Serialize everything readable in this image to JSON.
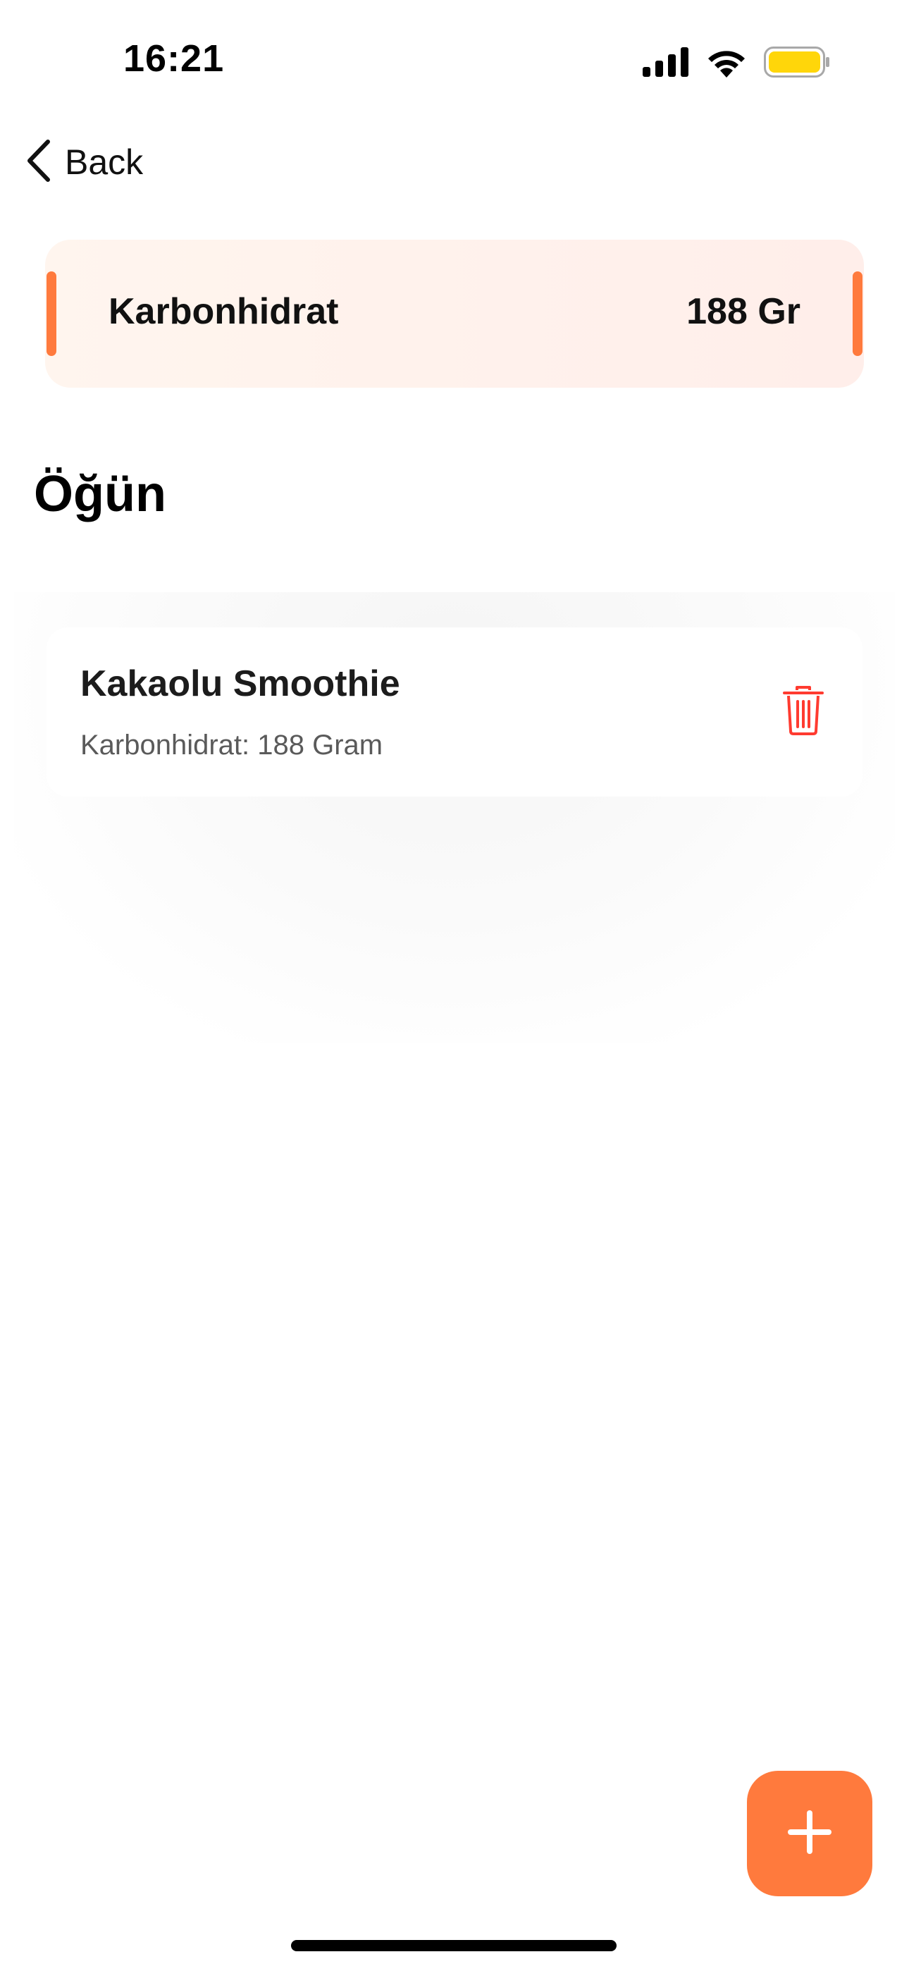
{
  "status_bar": {
    "time": "16:21",
    "signal_icon": "cellular-signal-icon",
    "wifi_icon": "wifi-icon",
    "battery_icon": "battery-icon",
    "battery_color": "#ffd60a"
  },
  "nav": {
    "back_label": "Back",
    "back_icon": "chevron-left-icon"
  },
  "summary": {
    "label": "Karbonhidrat",
    "value": "188 Gr",
    "accent_color": "#ff7a3d"
  },
  "section": {
    "title": "Öğün"
  },
  "meals": [
    {
      "name": "Kakaolu Smoothie",
      "detail": "Karbonhidrat: 188 Gram",
      "delete_icon": "trash-icon",
      "delete_color": "#ff3b30"
    }
  ],
  "fab": {
    "icon": "plus-icon",
    "color": "#ff7a3d"
  }
}
